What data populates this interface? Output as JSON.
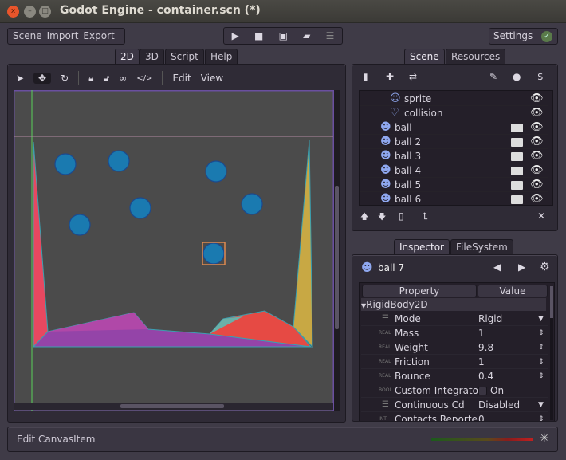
{
  "window": {
    "title": "Godot Engine - container.scn (*)",
    "close": "x",
    "min": "–",
    "max": "□"
  },
  "menu": [
    "Scene",
    "Import",
    "Export"
  ],
  "playbar": {
    "icons": [
      "play-icon",
      "stop-icon",
      "play-scene-icon",
      "open-folder-icon",
      "debug-menu-icon"
    ]
  },
  "settings": {
    "label": "Settings",
    "check": "✓"
  },
  "main_tabs": [
    "2D",
    "3D",
    "Script",
    "Help"
  ],
  "canvas_toolbar": {
    "menus": [
      "Edit",
      "View"
    ]
  },
  "scene_tabs": [
    "Scene",
    "Resources"
  ],
  "scene_tree": [
    {
      "label": "sprite",
      "type": "sprite",
      "indent": 2,
      "folder": false
    },
    {
      "label": "collision",
      "type": "collision",
      "indent": 2,
      "folder": false
    },
    {
      "label": "ball",
      "type": "rigidbody",
      "indent": 1,
      "folder": true
    },
    {
      "label": "ball 2",
      "type": "rigidbody",
      "indent": 1,
      "folder": true
    },
    {
      "label": "ball 3",
      "type": "rigidbody",
      "indent": 1,
      "folder": true
    },
    {
      "label": "ball 4",
      "type": "rigidbody",
      "indent": 1,
      "folder": true
    },
    {
      "label": "ball 5",
      "type": "rigidbody",
      "indent": 1,
      "folder": true
    },
    {
      "label": "ball 6",
      "type": "rigidbody",
      "indent": 1,
      "folder": true
    }
  ],
  "inspector_tabs": [
    "Inspector",
    "FileSystem"
  ],
  "inspector": {
    "object": "ball 7",
    "col_property": "Property",
    "col_value": "Value",
    "section": "RigidBody2D",
    "properties": [
      {
        "type": "",
        "name": "Mode",
        "value": "Rigid",
        "control": "dropdown"
      },
      {
        "type": "REAL",
        "name": "Mass",
        "value": "1",
        "control": "spin"
      },
      {
        "type": "REAL",
        "name": "Weight",
        "value": "9.8",
        "control": "spin"
      },
      {
        "type": "REAL",
        "name": "Friction",
        "value": "1",
        "control": "spin"
      },
      {
        "type": "REAL",
        "name": "Bounce",
        "value": "0.4",
        "control": "spin"
      },
      {
        "type": "BOOL",
        "name": "Custom Integrato",
        "value": "On",
        "control": "checkbox"
      },
      {
        "type": "",
        "name": "Continuous Cd",
        "value": "Disabled",
        "control": "dropdown"
      },
      {
        "type": "INT",
        "name": "Contacts Reporte",
        "value": "0",
        "control": "spin"
      }
    ]
  },
  "status": {
    "label": "Edit CanvasItem"
  },
  "colors": {
    "accent": "#8fa8f0",
    "selection": "#e08a50",
    "viewport": "#4b4b4b"
  }
}
